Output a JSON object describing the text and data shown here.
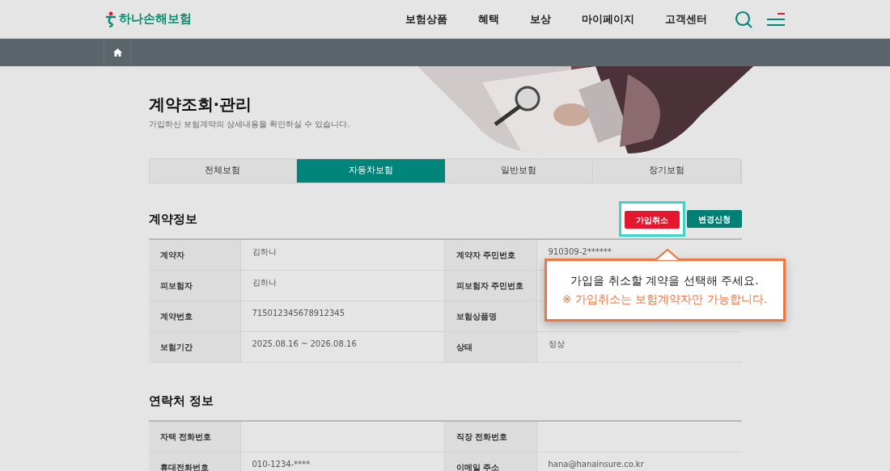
{
  "header": {
    "logo": "하나손해보험",
    "nav": [
      "보험상품",
      "혜택",
      "보상",
      "마이페이지",
      "고객센터"
    ]
  },
  "page": {
    "title": "계약조회·관리",
    "subtitle": "가입하신 보험계약의 상세내용을 확인하실 수 있습니다."
  },
  "tabs": [
    {
      "label": "전체보험",
      "selected": false
    },
    {
      "label": "자동차보험",
      "selected": true
    },
    {
      "label": "일반보험",
      "selected": false
    },
    {
      "label": "장기보험",
      "selected": false
    }
  ],
  "contract_section": {
    "title": "계약정보",
    "buttons": [
      {
        "label": "가입취소",
        "kind": "cancel",
        "highlighted": true
      },
      {
        "label": "변경신청",
        "kind": "change",
        "highlighted": false
      }
    ],
    "rows": [
      [
        {
          "label": "계약자",
          "value": "김하나"
        },
        {
          "label": "계약자 주민번호",
          "value": "910309-2******"
        }
      ],
      [
        {
          "label": "피보험자",
          "value": "김하나"
        },
        {
          "label": "피보험자 주민번호"
        }
      ],
      [
        {
          "label": "계약번호",
          "value": "715012345678912345"
        },
        {
          "label": "보험상품명"
        }
      ],
      [
        {
          "label": "보험기간",
          "value": "2025.08.16 ~ 2026.08.16"
        },
        {
          "label": "상태",
          "value": "정상"
        }
      ]
    ],
    "tooltip": {
      "message": "가입을 취소할 계약을 선택해 주세요.",
      "note": "※ 가입취소는 보험계약자만 가능합니다."
    }
  },
  "contact_section": {
    "title": "연락처 정보",
    "rows": [
      [
        {
          "label": "자택 전화번호"
        },
        {
          "label": "직장 전화번호"
        }
      ],
      [
        {
          "label": "휴대전화번호",
          "value": "010-1234-****"
        },
        {
          "label": "이메일 주소",
          "value": "hana@hanainsure.co.kr"
        }
      ]
    ]
  }
}
